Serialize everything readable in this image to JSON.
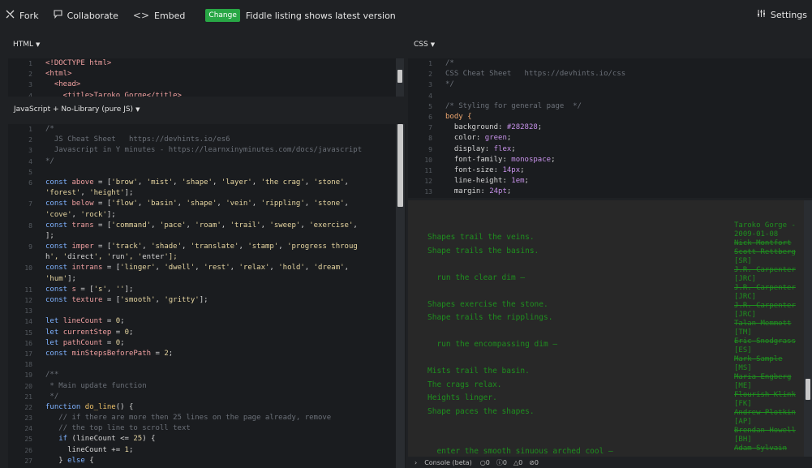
{
  "toolbar": {
    "fork": "Fork",
    "collaborate": "Collaborate",
    "embed": "Embed",
    "change": "Change",
    "fiddle_msg": "Fiddle listing shows latest version",
    "settings": "Settings"
  },
  "panels": {
    "html_label": "HTML",
    "js_label": "JavaScript + No-Library (pure JS)",
    "css_label": "CSS",
    "console_label": "Console (beta)",
    "console_counts": [
      "0",
      "0",
      "0",
      "0"
    ]
  },
  "html_code": [
    {
      "n": "1",
      "t": "<!DOCTYPE html>"
    },
    {
      "n": "2",
      "t": "<html>"
    },
    {
      "n": "3",
      "t": "  <head>"
    },
    {
      "n": "4",
      "t": "    <title>Taroko Gorge</title>"
    }
  ],
  "js_code": [
    {
      "n": "1",
      "t": "/*"
    },
    {
      "n": "2",
      "t": "  JS Cheat Sheet   https://devhints.io/es6"
    },
    {
      "n": "3",
      "t": "  Javascript in Y minutes - https://learnxinyminutes.com/docs/javascript"
    },
    {
      "n": "4",
      "t": "*/"
    },
    {
      "n": "5",
      "t": ""
    },
    {
      "n": "6",
      "t": "const above = ['brow', 'mist', 'shape', 'layer', 'the crag', 'stone',"
    },
    {
      "n": "",
      "t": "'forest', 'height'];"
    },
    {
      "n": "7",
      "t": "const below = ['flow', 'basin', 'shape', 'vein', 'rippling', 'stone',"
    },
    {
      "n": "",
      "t": "'cove', 'rock'];"
    },
    {
      "n": "8",
      "t": "const trans = ['command', 'pace', 'roam', 'trail', 'sweep', 'exercise',"
    },
    {
      "n": "",
      "t": "];"
    },
    {
      "n": "9",
      "t": "const imper = ['track', 'shade', 'translate', 'stamp', 'progress throug"
    },
    {
      "n": "",
      "t": "h', 'direct', 'run', 'enter'];"
    },
    {
      "n": "10",
      "t": "const intrans = ['linger', 'dwell', 'rest', 'relax', 'hold', 'dream',"
    },
    {
      "n": "",
      "t": "'hum'];"
    },
    {
      "n": "11",
      "t": "const s = ['s', ''];"
    },
    {
      "n": "12",
      "t": "const texture = ['smooth', 'gritty'];"
    },
    {
      "n": "13",
      "t": ""
    },
    {
      "n": "14",
      "t": "let lineCount = 0;"
    },
    {
      "n": "15",
      "t": "let currentStep = 0;"
    },
    {
      "n": "16",
      "t": "let pathCount = 0;"
    },
    {
      "n": "17",
      "t": "const minStepsBeforePath = 2;"
    },
    {
      "n": "18",
      "t": ""
    },
    {
      "n": "19",
      "t": "/**"
    },
    {
      "n": "20",
      "t": " * Main update function"
    },
    {
      "n": "21",
      "t": " */"
    },
    {
      "n": "22",
      "t": "function do_line() {"
    },
    {
      "n": "23",
      "t": "   // if there are more then 25 lines on the page already, remove"
    },
    {
      "n": "24",
      "t": "   // the top line to scroll text"
    },
    {
      "n": "25",
      "t": "   if (lineCount <= 25) {"
    },
    {
      "n": "26",
      "t": "     lineCount += 1;"
    },
    {
      "n": "27",
      "t": "   } else {"
    }
  ],
  "css_code": [
    {
      "n": "1",
      "t": "/*"
    },
    {
      "n": "2",
      "t": "CSS Cheat Sheet   https://devhints.io/css"
    },
    {
      "n": "3",
      "t": "*/"
    },
    {
      "n": "4",
      "t": ""
    },
    {
      "n": "5",
      "t": "/* Styling for general page  */"
    },
    {
      "n": "6",
      "t": "body {"
    },
    {
      "n": "7",
      "t": "  background: #282828;"
    },
    {
      "n": "8",
      "t": "  color: green;"
    },
    {
      "n": "9",
      "t": "  display: flex;"
    },
    {
      "n": "10",
      "t": "  font-family: monospace;"
    },
    {
      "n": "11",
      "t": "  font-size: 14px;"
    },
    {
      "n": "12",
      "t": "  line-height: 1em;"
    },
    {
      "n": "13",
      "t": "  margin: 24pt;"
    }
  ],
  "poem": [
    "Shapes trail the veins.",
    "Shape trails the basins.",
    "",
    "  run the clear dim —",
    "",
    "Shapes exercise the stone.",
    "Shape trails the ripplings.",
    "",
    "  run the encompassing dim —",
    "",
    "Mists trail the basin.",
    "The crags relax.",
    "Heights linger.",
    "Shape paces the shapes.",
    "",
    "",
    "  enter the smooth sinuous arched cool —"
  ],
  "credits": [
    {
      "t": "Taroko Gorge -",
      "s": false
    },
    {
      "t": "2009-01-08",
      "s": false
    },
    {
      "t": "Nick Montfort",
      "s": true
    },
    {
      "t": "Scott Rettberg",
      "s": true
    },
    {
      "t": "[SR]",
      "s": false
    },
    {
      "t": "J.R. Carpenter",
      "s": true
    },
    {
      "t": "[JRC]",
      "s": false
    },
    {
      "t": "J.R. Carpenter",
      "s": true
    },
    {
      "t": "[JRC]",
      "s": false
    },
    {
      "t": "J.R. Carpenter",
      "s": true
    },
    {
      "t": "[JRC]",
      "s": false
    },
    {
      "t": "Talan Memmott",
      "s": true
    },
    {
      "t": "[TM]",
      "s": false
    },
    {
      "t": "Eric Snodgrass",
      "s": true
    },
    {
      "t": "[ES]",
      "s": false
    },
    {
      "t": "Mark Sample",
      "s": true
    },
    {
      "t": "[MS]",
      "s": false
    },
    {
      "t": "Maria Engberg",
      "s": true
    },
    {
      "t": "[ME]",
      "s": false
    },
    {
      "t": "Flourish Klink",
      "s": true
    },
    {
      "t": "[FK]",
      "s": false
    },
    {
      "t": "Andrew Plotkin",
      "s": true
    },
    {
      "t": "[AP]",
      "s": false
    },
    {
      "t": "Brendan Howell",
      "s": true
    },
    {
      "t": "[BH]",
      "s": false
    },
    {
      "t": "Adam Sylvain",
      "s": true
    }
  ],
  "colors": {
    "background": "#1f2124",
    "editor": "#1a1c1f",
    "output_bg": "#282828",
    "output_text": "#1f8f1f",
    "change_button": "#28a745"
  },
  "icons": [
    "fork-icon",
    "collaborate-icon",
    "embed-icon",
    "settings-icon"
  ]
}
